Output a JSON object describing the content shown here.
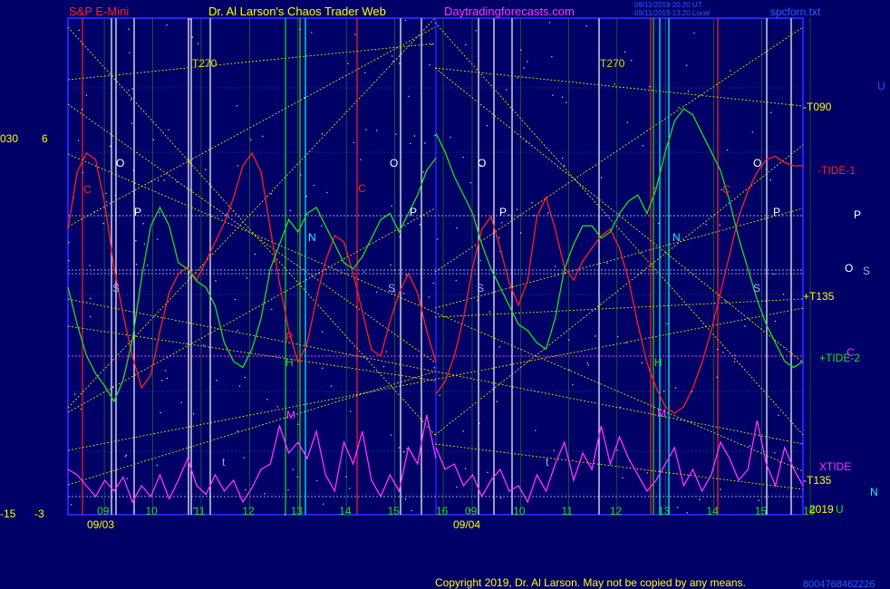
{
  "header": {
    "instrument": "S&P E-Mini",
    "site": "Dr. Al Larson's Chaos Trader Web",
    "url": "Daytradingforecasts.com",
    "generated_1": "09/11/2019 20:20 UT",
    "generated_2": "09/11/2019 13:20 Local",
    "spec_file": "spcforn.txt"
  },
  "left_scale": {
    "top_a": "030",
    "top_b": "6",
    "bottom_a": "-15",
    "bottom_b": "-3"
  },
  "right_labels": {
    "u": "U",
    "t090": "-T090",
    "tide1": "-TIDE-1",
    "p": "P",
    "o": "O",
    "s": "S",
    "t135p": "+T135",
    "tide2": "+TIDE-2",
    "c": "C",
    "xtide": "XTIDE",
    "t135m": "-T135",
    "n": "N",
    "year": "2019",
    "year_suffix": "U"
  },
  "date_labels": {
    "day1": "09/03",
    "day2": "09/04"
  },
  "footer": {
    "copyright": "Copyright 2019, Dr. Al Larson. May not be copied by any means.",
    "number": "8004768462226"
  },
  "colors": {
    "background": "#000066",
    "plot_border": "#2222ff",
    "tide1": "#ff2020",
    "tide2": "#20dd20",
    "xtide": "#ff33ff",
    "fan": "#dddd00",
    "white_line": "#ffffff",
    "cyan": "#00ffff",
    "blue_text": "#2a5cff",
    "yellow_text": "#ffff00"
  },
  "chart_data": {
    "type": "line",
    "title": "S&P E-Mini",
    "days": [
      {
        "date": "09/03",
        "hour_ticks": [
          "09",
          "10",
          "11",
          "12",
          "13",
          "14",
          "15",
          "16"
        ]
      },
      {
        "date": "09/04",
        "hour_ticks": [
          "09",
          "10",
          "11",
          "12",
          "13",
          "14",
          "15",
          "16"
        ]
      }
    ],
    "x_unit": "hour",
    "series": [
      {
        "name": "-TIDE-1",
        "values_day1": [
          0.62,
          0.8,
          0.86,
          0.84,
          0.7,
          0.5,
          0.35,
          0.22,
          0.12,
          0.16,
          0.3,
          0.42,
          0.48,
          0.5,
          0.46,
          0.52,
          0.58,
          0.64,
          0.72,
          0.82,
          0.86,
          0.8,
          0.62,
          0.45,
          0.3,
          0.2,
          0.26,
          0.4,
          0.52,
          0.6,
          0.58,
          0.48,
          0.36,
          0.24,
          0.22,
          0.33,
          0.42,
          0.48,
          0.42,
          0.3,
          0.2
        ],
        "values_day2": [
          0.1,
          0.14,
          0.22,
          0.34,
          0.5,
          0.62,
          0.66,
          0.56,
          0.45,
          0.38,
          0.46,
          0.66,
          0.72,
          0.62,
          0.5,
          0.46,
          0.52,
          0.56,
          0.6,
          0.62,
          0.56,
          0.46,
          0.32,
          0.2,
          0.12,
          0.06,
          0.04,
          0.06,
          0.12,
          0.2,
          0.3,
          0.42,
          0.54,
          0.66,
          0.74,
          0.8,
          0.84,
          0.85,
          0.83,
          0.82,
          0.82
        ]
      },
      {
        "name": "+TIDE-2",
        "values_day1": [
          0.42,
          0.3,
          0.2,
          0.14,
          0.1,
          0.05,
          0.12,
          0.25,
          0.45,
          0.62,
          0.68,
          0.62,
          0.5,
          0.48,
          0.44,
          0.42,
          0.36,
          0.24,
          0.18,
          0.16,
          0.22,
          0.32,
          0.48,
          0.56,
          0.64,
          0.6,
          0.66,
          0.68,
          0.62,
          0.56,
          0.5,
          0.48,
          0.52,
          0.58,
          0.64,
          0.66,
          0.6,
          0.66,
          0.72,
          0.8,
          0.84
        ],
        "values_day2": [
          0.92,
          0.86,
          0.78,
          0.72,
          0.66,
          0.56,
          0.48,
          0.42,
          0.36,
          0.3,
          0.28,
          0.24,
          0.22,
          0.32,
          0.48,
          0.56,
          0.62,
          0.62,
          0.58,
          0.6,
          0.66,
          0.7,
          0.72,
          0.66,
          0.74,
          0.86,
          0.96,
          1.0,
          0.98,
          0.92,
          0.86,
          0.8,
          0.7,
          0.58,
          0.48,
          0.38,
          0.3,
          0.24,
          0.18,
          0.16,
          0.18
        ]
      },
      {
        "name": "XTIDE",
        "values_day1": [
          0.35,
          0.3,
          0.2,
          0.1,
          0.25,
          0.15,
          0.28,
          0.05,
          0.2,
          0.1,
          0.3,
          0.08,
          0.25,
          0.45,
          0.2,
          0.12,
          0.3,
          0.15,
          0.25,
          0.05,
          0.18,
          0.35,
          0.4,
          0.75,
          0.5,
          0.6,
          0.45,
          0.7,
          0.3,
          0.15,
          0.6,
          0.4,
          0.7,
          0.25,
          0.1,
          0.3,
          0.15,
          0.55,
          0.4,
          0.85,
          0.45
        ],
        "values_day2": [
          0.55,
          0.35,
          0.4,
          0.2,
          0.3,
          0.1,
          0.25,
          0.35,
          0.15,
          0.2,
          0.05,
          0.3,
          0.15,
          0.4,
          0.6,
          0.25,
          0.5,
          0.35,
          0.75,
          0.4,
          0.65,
          0.45,
          0.3,
          0.15,
          0.25,
          0.4,
          0.55,
          0.2,
          0.35,
          0.15,
          0.3,
          0.6,
          0.45,
          0.25,
          0.35,
          0.8,
          0.4,
          0.2,
          0.55,
          0.35,
          0.2
        ]
      }
    ],
    "markers": [
      {
        "label": "C",
        "color": "#ff2020"
      },
      {
        "label": "O",
        "color": "#ffffff"
      },
      {
        "label": "P",
        "color": "#ffffff"
      },
      {
        "label": "S",
        "color": "#ffffff"
      },
      {
        "label": "N",
        "color": "#00ffff"
      },
      {
        "label": "H",
        "color": "#20dd20"
      },
      {
        "label": "M",
        "color": "#ff33ff"
      },
      {
        "label": "R",
        "color": "#ff2020"
      },
      {
        "label": "t",
        "color": "#aaaaff"
      }
    ],
    "fan_lines": [
      "T270",
      "T270",
      "-T090",
      "+T135",
      "-T135"
    ],
    "grid": true,
    "legend": "right"
  }
}
